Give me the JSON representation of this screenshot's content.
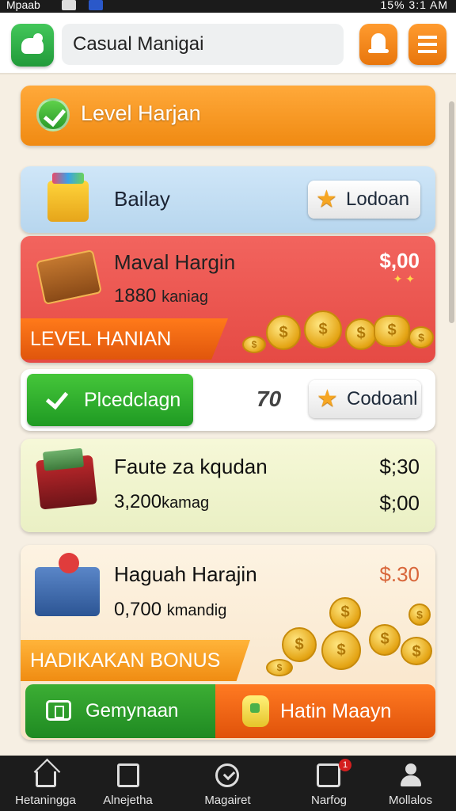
{
  "status_bar": {
    "left_text": "Mpaab",
    "right_text": "15% 3:1 AM"
  },
  "header": {
    "title": "Casual Manigai",
    "app_icon": "app-logo-icon",
    "bell_icon": "bell-icon",
    "menu_icon": "menu-icon"
  },
  "cards": {
    "level": {
      "label": "Level Harjan"
    },
    "bailay": {
      "name": "Bailay",
      "button_label": "Lodoan"
    },
    "maval": {
      "name": "Maval Hargin",
      "count": "1880",
      "count_unit": "kaniag",
      "price": "$,00",
      "ribbon": "LEVEL HANIAN"
    },
    "pledge": {
      "button_label": "Plcedclagn",
      "number": "70",
      "star_button_label": "Codoanl"
    },
    "fauto": {
      "name": "Faute za kqudan",
      "count": "3,200",
      "count_unit": "kamag",
      "price_top": "$;30",
      "price_bottom": "$;00"
    },
    "haguah": {
      "name": "Haguah Harajin",
      "count": "0,700",
      "count_unit": "kmandig",
      "price": "$.30",
      "ribbon": "HADIKAKAN BONUS"
    }
  },
  "actions": {
    "left_label": "Gemynaan",
    "right_label": "Hatin Maayn"
  },
  "nav": {
    "items": [
      {
        "label": "Hetaningga",
        "icon": "home-icon"
      },
      {
        "label": "Alnejetha",
        "icon": "document-icon"
      },
      {
        "label": "Magairet",
        "icon": "clock-icon"
      },
      {
        "label": "Narfog",
        "icon": "inbox-icon",
        "badge": "1"
      },
      {
        "label": "Mollalos",
        "icon": "profile-icon"
      }
    ]
  },
  "colors": {
    "orange": "#f08a12",
    "green": "#1f9a23",
    "red": "#e54a44",
    "blue_card": "#cfe6f8"
  }
}
